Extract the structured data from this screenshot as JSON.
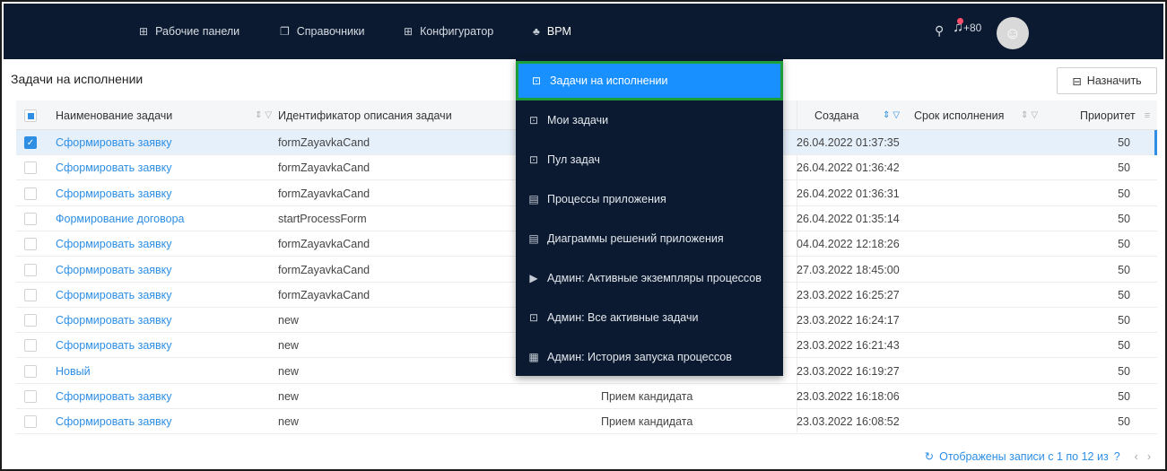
{
  "nav": {
    "items": [
      {
        "icon": "grid-icon",
        "label": "Рабочие панели"
      },
      {
        "icon": "book-icon",
        "label": "Справочники"
      },
      {
        "icon": "grid-icon",
        "label": "Конфигуратор"
      },
      {
        "icon": "sitemap-icon",
        "label": "BPM"
      }
    ],
    "notifications_count": "+80"
  },
  "page": {
    "title": "Задачи на исполнении",
    "assign_label": "Назначить"
  },
  "table": {
    "columns": {
      "name": "Наименование задачи",
      "descriptor": "Идентификатор описания задачи",
      "created": "Создана",
      "deadline": "Срок исполнения",
      "priority": "Приоритет"
    },
    "rows": [
      {
        "name": "Сформировать заявку",
        "descriptor": "formZayavkaCand",
        "process": "",
        "created": "26.04.2022 01:37:35",
        "priority": "50",
        "selected": true
      },
      {
        "name": "Сформировать заявку",
        "descriptor": "formZayavkaCand",
        "process": "",
        "created": "26.04.2022 01:36:42",
        "priority": "50",
        "selected": false
      },
      {
        "name": "Сформировать заявку",
        "descriptor": "formZayavkaCand",
        "process": "",
        "created": "26.04.2022 01:36:31",
        "priority": "50",
        "selected": false
      },
      {
        "name": "Формирование договора",
        "descriptor": "startProcessForm",
        "process": "",
        "created": "26.04.2022 01:35:14",
        "priority": "50",
        "selected": false
      },
      {
        "name": "Сформировать заявку",
        "descriptor": "formZayavkaCand",
        "process": "",
        "created": "04.04.2022 12:18:26",
        "priority": "50",
        "selected": false
      },
      {
        "name": "Сформировать заявку",
        "descriptor": "formZayavkaCand",
        "process": "",
        "created": "27.03.2022 18:45:00",
        "priority": "50",
        "selected": false
      },
      {
        "name": "Сформировать заявку",
        "descriptor": "formZayavkaCand",
        "process": "",
        "created": "23.03.2022 16:25:27",
        "priority": "50",
        "selected": false
      },
      {
        "name": "Сформировать заявку",
        "descriptor": "new",
        "process": "",
        "created": "23.03.2022 16:24:17",
        "priority": "50",
        "selected": false
      },
      {
        "name": "Сформировать заявку",
        "descriptor": "new",
        "process": "",
        "created": "23.03.2022 16:21:43",
        "priority": "50",
        "selected": false
      },
      {
        "name": "Новый",
        "descriptor": "new",
        "process": "",
        "created": "23.03.2022 16:19:27",
        "priority": "50",
        "selected": false
      },
      {
        "name": "Сформировать заявку",
        "descriptor": "new",
        "process": "Прием кандидата",
        "created": "23.03.2022 16:18:06",
        "priority": "50",
        "selected": false
      },
      {
        "name": "Сформировать заявку",
        "descriptor": "new",
        "process": "Прием кандидата",
        "created": "23.03.2022 16:08:52",
        "priority": "50",
        "selected": false
      }
    ]
  },
  "footer": {
    "records_text": "Отображены записи с 1 по 12 из",
    "question": "?"
  },
  "bpm_menu": {
    "items": [
      {
        "icon": "task-icon",
        "label": "Задачи на исполнении",
        "active": true
      },
      {
        "icon": "task-icon",
        "label": "Мои задачи",
        "active": false
      },
      {
        "icon": "task-icon",
        "label": "Пул задач",
        "active": false
      },
      {
        "icon": "document-icon",
        "label": "Процессы приложения",
        "active": false
      },
      {
        "icon": "document-icon",
        "label": "Диаграммы решений приложения",
        "active": false
      },
      {
        "icon": "play-square-icon",
        "label": "Админ: Активные экземпляры процессов",
        "active": false
      },
      {
        "icon": "task-icon",
        "label": "Админ: Все активные задачи",
        "active": false
      },
      {
        "icon": "history-icon",
        "label": "Админ: История запуска процессов",
        "active": false
      }
    ]
  }
}
